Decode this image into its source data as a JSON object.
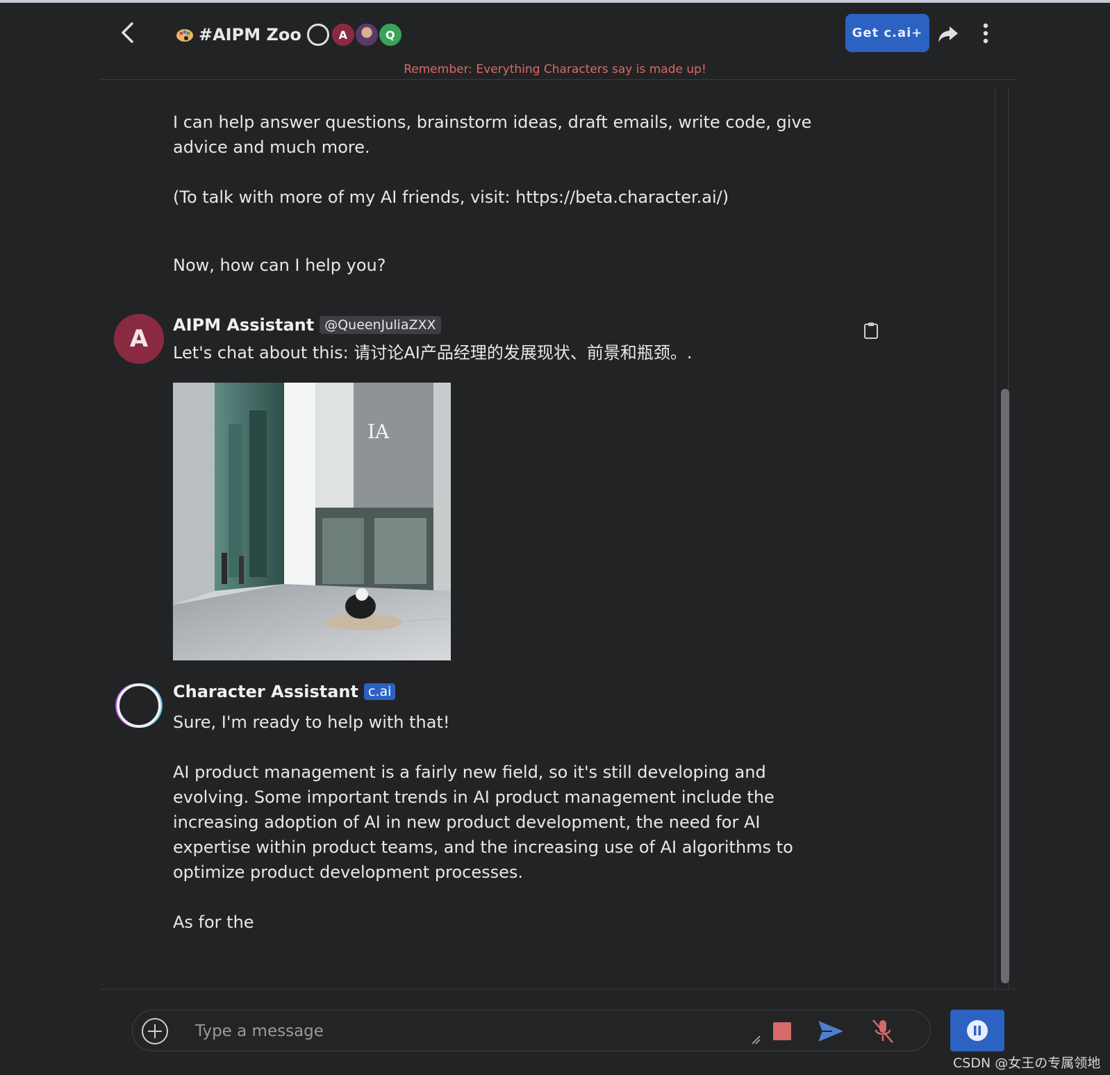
{
  "header": {
    "room_title": "#AIPM Zoo",
    "avatars": [
      {
        "label": "",
        "kind": "ring"
      },
      {
        "label": "A",
        "color": "#8a2a40"
      },
      {
        "label": "",
        "kind": "photo"
      },
      {
        "label": "Q",
        "color": "#3aa35a"
      }
    ],
    "get_plus_label": "Get c.ai+",
    "warning": "Remember: Everything Characters say is made up!"
  },
  "messages": {
    "intro": {
      "p1": "I can help answer questions, brainstorm ideas, draft emails, write code, give advice and much more.",
      "p2": "(To talk with more of my AI friends, visit: https://beta.character.ai/)",
      "p3": "Now, how can I help you?"
    },
    "user": {
      "avatar_letter": "A",
      "name": "AIPM Assistant",
      "handle": "@QueenJuliaZXX",
      "text": "Let's chat about this: 请讨论AI产品经理的发展现状、前景和瓶颈。."
    },
    "bot": {
      "name": "Character Assistant",
      "badge": "c.ai",
      "p1": "Sure, I'm ready to help with that!",
      "p2": "AI product management is a fairly new field, so it's still developing and evolving. Some important trends in AI product management include the increasing adoption of AI in new product development, the need for AI expertise within product teams, and the increasing use of AI algorithms to optimize product development processes.",
      "p3": "As for the"
    }
  },
  "composer": {
    "placeholder": "Type a message"
  },
  "watermark": "CSDN @女王の专属领地",
  "colors": {
    "background": "#222324",
    "accent": "#2c62c2",
    "warning": "#e06868",
    "stop": "#d56a6a",
    "user_avatar": "#8a2a40"
  },
  "icons": [
    "back-arrow-icon",
    "paint-palette-icon",
    "share-arrow-icon",
    "more-vertical-icon",
    "clipboard-icon",
    "plus-circle-icon",
    "stop-icon",
    "send-icon",
    "mic-off-icon",
    "pause-icon"
  ]
}
